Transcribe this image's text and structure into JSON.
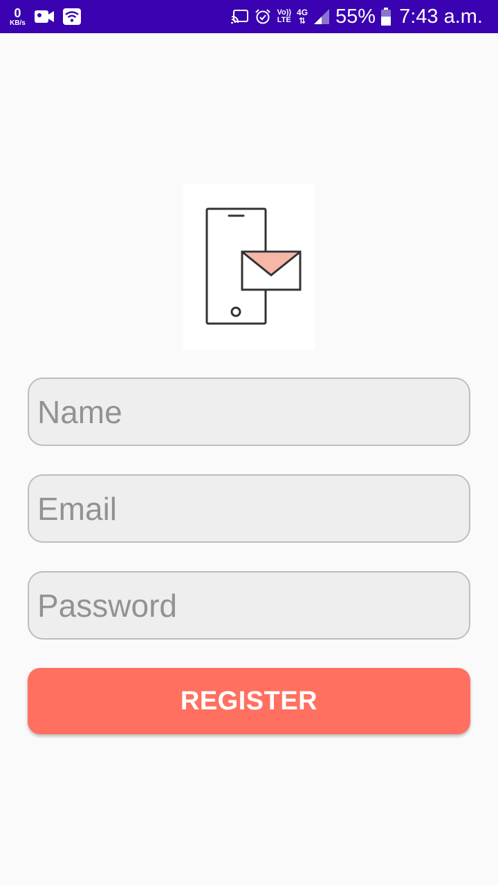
{
  "status_bar": {
    "net_speed_value": "0",
    "net_speed_unit": "KB/s",
    "volte_top": "Vo))",
    "volte_bottom": "LTE",
    "network_type": "4G",
    "network_arrows": "⇅",
    "battery_percent": "55%",
    "time": "7:43 a.m.",
    "icons": [
      "video-camera-icon",
      "wifi-icon",
      "cast-icon",
      "alarm-icon",
      "signal-icon",
      "battery-icon"
    ]
  },
  "logo": {
    "icon": "phone-envelope-icon",
    "accent_color": "#f7b6a6"
  },
  "form": {
    "name_placeholder": "Name",
    "email_placeholder": "Email",
    "password_placeholder": "Password",
    "register_label": "REGISTER"
  },
  "colors": {
    "status_bar": "#3a02b0",
    "button": "#ff7060",
    "field_background": "#eeeeee",
    "field_border": "#bdbdbd",
    "page_background": "#fafafa"
  }
}
